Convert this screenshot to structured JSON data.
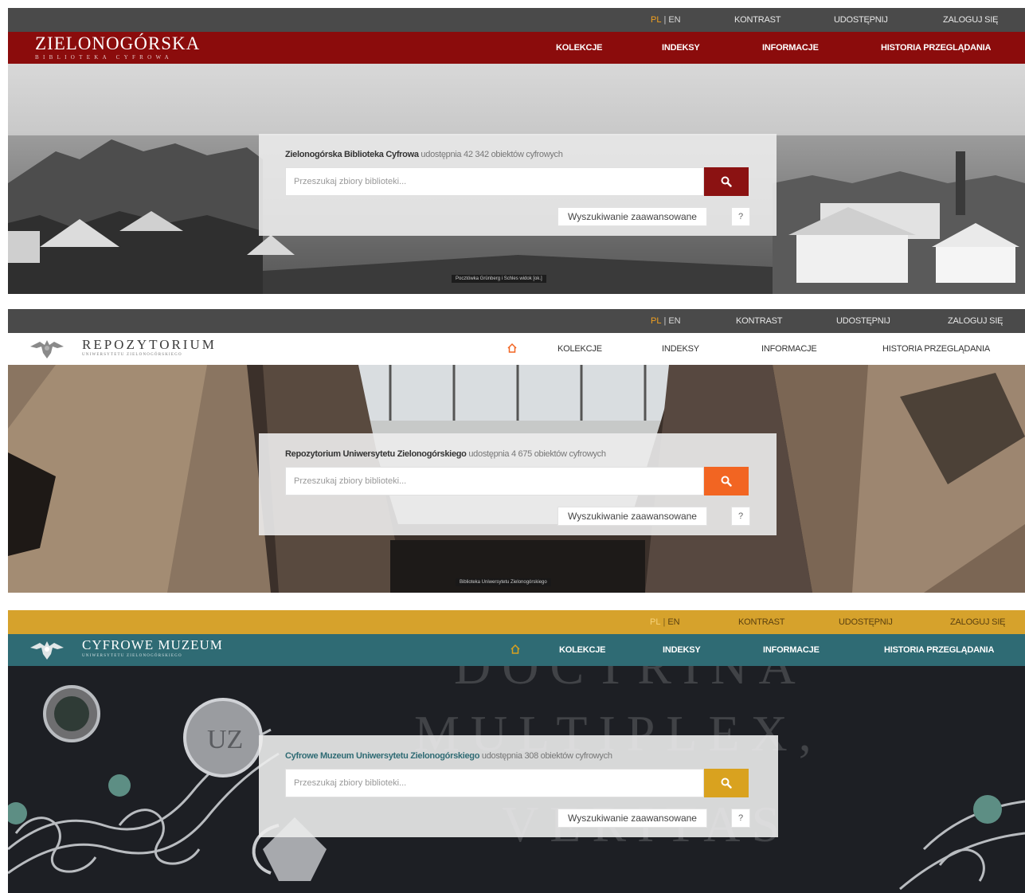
{
  "sites": [
    {
      "logo": {
        "main": "ZIELONOGÓRSKA",
        "sub": "BIBLIOTEKA CYFROWA"
      },
      "topbar": {
        "lang_active": "PL",
        "lang_sep": "|",
        "lang_other": "EN",
        "contrast": "KONTRAST",
        "share": "UDOSTĘPNIJ",
        "login": "ZALOGUJ SIĘ"
      },
      "nav": [
        "KOLEKCJE",
        "INDEKSY",
        "INFORMACJE",
        "HISTORIA PRZEGLĄDANIA"
      ],
      "search": {
        "org": "Zielonogórska Biblioteka Cyfrowa",
        "tagline_rest": " udostępnia 42 342 obiektów cyfrowych",
        "placeholder": "Przeszukaj zbiory biblioteki...",
        "advanced": "Wyszukiwanie zaawansowane",
        "help": "?"
      },
      "caption": "Pocztówka Grünberg i Schles widok [ok.]",
      "colors": {
        "topbar": "#4a4a4a",
        "navbar": "#8b0c0c",
        "button": "#8b1212",
        "nav_text": "#ffffff"
      }
    },
    {
      "logo": {
        "main": "REPOZYTORIUM",
        "sub": "UNIWERSYTETU ZIELONOGÓRSKIEGO"
      },
      "topbar": {
        "lang_active": "PL",
        "lang_sep": "|",
        "lang_other": "EN",
        "contrast": "KONTRAST",
        "share": "UDOSTĘPNIJ",
        "login": "ZALOGUJ SIĘ"
      },
      "nav": [
        "KOLEKCJE",
        "INDEKSY",
        "INFORMACJE",
        "HISTORIA PRZEGLĄDANIA"
      ],
      "search": {
        "org": "Repozytorium Uniwersytetu Zielonogórskiego",
        "tagline_rest": " udostępnia 4 675 obiektów cyfrowych",
        "placeholder": "Przeszukaj zbiory biblioteki...",
        "advanced": "Wyszukiwanie zaawansowane",
        "help": "?"
      },
      "caption": "Biblioteka Uniwersytetu Zielonogórskiego",
      "colors": {
        "topbar": "#4a4a4a",
        "navbar": "#ffffff",
        "button": "#f26522",
        "nav_text": "#333333"
      }
    },
    {
      "logo": {
        "main": "CYFROWE MUZEUM",
        "sub": "UNIWERSYTETU ZIELONOGÓRSKIEGO"
      },
      "topbar": {
        "lang_active": "PL",
        "lang_sep": "|",
        "lang_other": "EN",
        "contrast": "KONTRAST",
        "share": "UDOSTĘPNIJ",
        "login": "ZALOGUJ SIĘ"
      },
      "nav": [
        "KOLEKCJE",
        "INDEKSY",
        "INFORMACJE",
        "HISTORIA PRZEGLĄDANIA"
      ],
      "search": {
        "org": "Cyfrowe Muzeum Uniwersytetu Zielonogórskiego",
        "tagline_rest": " udostępnia 308 obiektów cyfrowych",
        "placeholder": "Przeszukaj zbiory biblioteki...",
        "advanced": "Wyszukiwanie zaawansowane",
        "help": "?"
      },
      "motto": [
        "DOCTRINA",
        "MULTIPLEX,",
        "VERITAS"
      ],
      "colors": {
        "topbar": "#d6a22c",
        "navbar": "#2f6b74",
        "button": "#d9a21f",
        "nav_text": "#ffffff"
      }
    }
  ]
}
